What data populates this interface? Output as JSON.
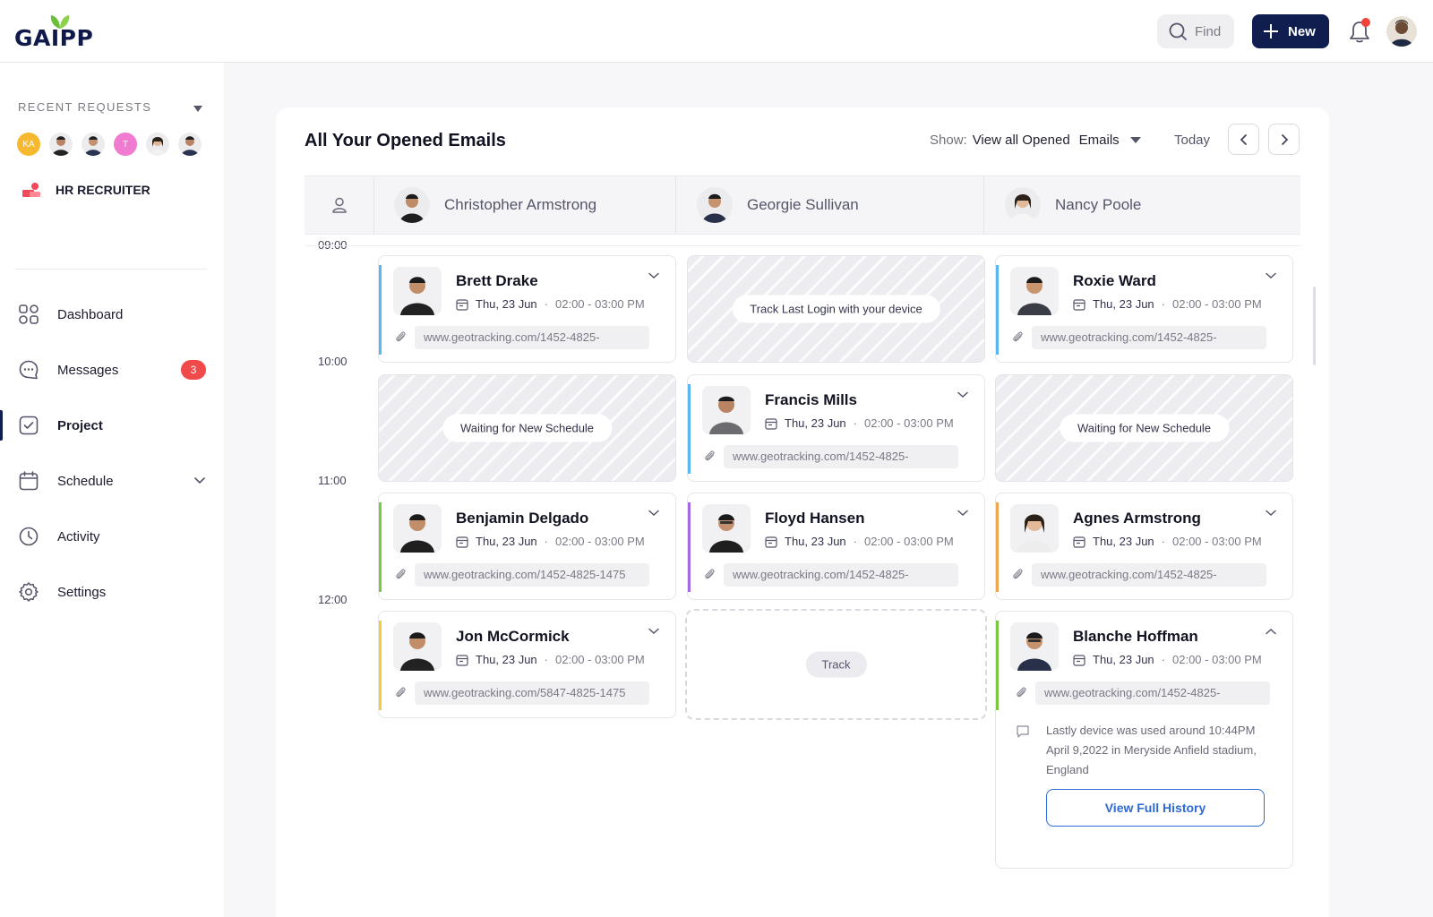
{
  "brand": {
    "name": "GAIPP"
  },
  "topbar": {
    "find_label": "Find",
    "new_label": "New",
    "colors": {
      "new_button": "#0f1d4f",
      "notification_dot": "#f0443a"
    }
  },
  "sidebar": {
    "recent_title": "RECENT REQUESTS",
    "recent_avatars": [
      {
        "initials": "KA",
        "color": "#f5b82e"
      },
      {
        "initials": "",
        "color": "#2e2e2e"
      },
      {
        "initials": "",
        "color": "#2e2e2e"
      },
      {
        "initials": "T",
        "color": "#f07bd0"
      },
      {
        "initials": "",
        "color": "#d9d9d9"
      },
      {
        "initials": "",
        "color": "#2e2e2e"
      }
    ],
    "role_label": "HR RECRUITER",
    "nav": [
      {
        "label": "Dashboard",
        "icon": "dashboard-grid-icon"
      },
      {
        "label": "Messages",
        "icon": "chat-bubble-icon",
        "badge": "3"
      },
      {
        "label": "Project",
        "icon": "checkbox-icon",
        "active": true
      },
      {
        "label": "Schedule",
        "icon": "calendar-icon"
      },
      {
        "label": "Activity",
        "icon": "clock-icon"
      },
      {
        "label": "Settings",
        "icon": "gear-icon"
      }
    ]
  },
  "main": {
    "title": "All Your Opened Emails",
    "show_prefix": "Show:",
    "show_value": "View all Opened",
    "show_filter": "Emails",
    "today_label": "Today",
    "columns": [
      "Christopher Armstrong",
      "Georgie Sullivan",
      "Nancy Poole"
    ],
    "times": [
      "09:00",
      "10:00",
      "11:00",
      "12:00"
    ]
  },
  "cards": {
    "brett": {
      "name": "Brett Drake",
      "date": "Thu, 23 Jun",
      "time": "02:00 - 03:00 PM",
      "link": "www.geotracking.com/1452-4825-",
      "accent": "#5ab7f0"
    },
    "roxie": {
      "name": "Roxie Ward",
      "date": "Thu, 23 Jun",
      "time": "02:00 - 03:00 PM",
      "link": "www.geotracking.com/1452-4825-",
      "accent": "#5ab7f0"
    },
    "francis": {
      "name": "Francis Mills",
      "date": "Thu, 23 Jun",
      "time": "02:00 - 03:00 PM",
      "link": "www.geotracking.com/1452-4825-",
      "accent": "#5ab7f0"
    },
    "benjamin": {
      "name": "Benjamin Delgado",
      "date": "Thu, 23 Jun",
      "time": "02:00 - 03:00 PM",
      "link": "www.geotracking.com/1452-4825-1475",
      "accent": "#7ac943"
    },
    "floyd": {
      "name": "Floyd Hansen",
      "date": "Thu, 23 Jun",
      "time": "02:00 - 03:00 PM",
      "link": "www.geotracking.com/1452-4825-",
      "accent": "#a46ae0"
    },
    "agnes": {
      "name": "Agnes Armstrong",
      "date": "Thu, 23 Jun",
      "time": "02:00 - 03:00 PM",
      "link": "www.geotracking.com/1452-4825-",
      "accent": "#f2a44e"
    },
    "jon": {
      "name": "Jon McCormick",
      "date": "Thu, 23 Jun",
      "time": "02:00 - 03:00 PM",
      "link": "www.geotracking.com/5847-4825-1475",
      "accent": "#f3cb3b"
    },
    "blanche": {
      "name": "Blanche Hoffman",
      "date": "Thu, 23 Jun",
      "time": "02:00 - 03:00 PM",
      "link": "www.geotracking.com/1452-4825-",
      "accent": "#7ac943",
      "note": "Lastly device was used around 10:44PM April 9,2022 in Meryside Anfield stadium, England",
      "button": "View Full History"
    }
  },
  "placeholders": {
    "track_login": "Track Last Login with your device",
    "waiting_1": "Waiting for New Schedule",
    "waiting_2": "Waiting for New Schedule",
    "track": "Track"
  }
}
